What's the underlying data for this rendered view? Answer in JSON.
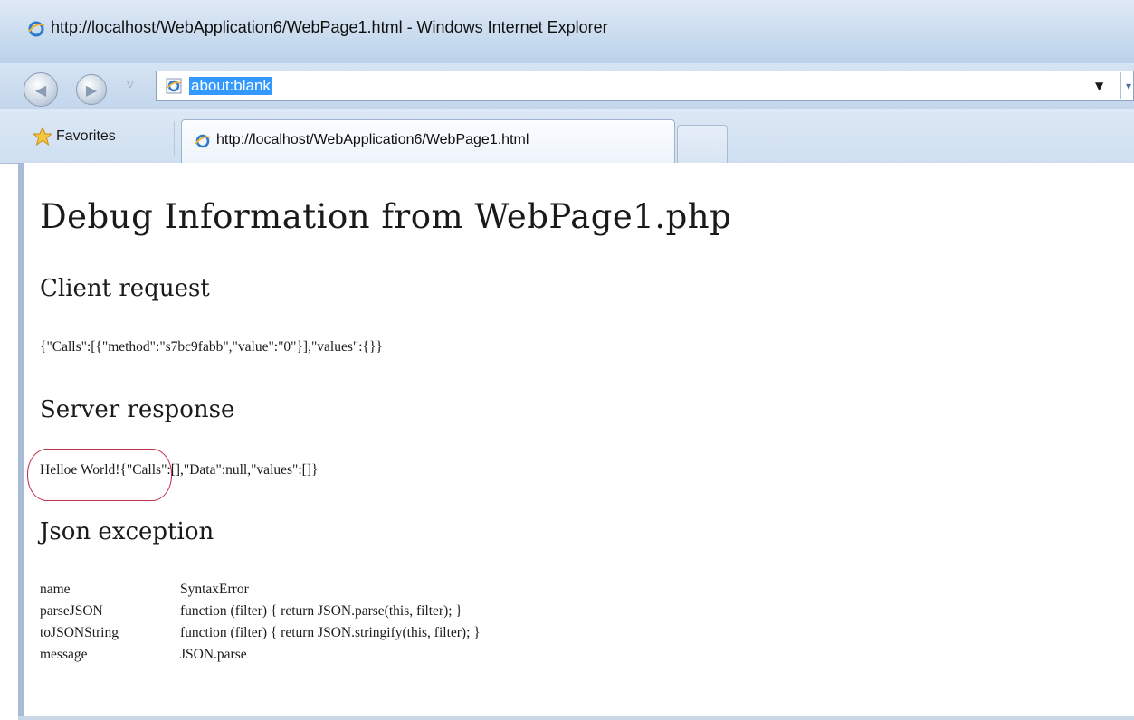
{
  "window": {
    "title": "http://localhost/WebApplication6/WebPage1.html - Windows Internet Explorer"
  },
  "navigation": {
    "address": "about:blank"
  },
  "favorites_bar": {
    "favorites_label": "Favorites",
    "active_tab_label": "http://localhost/WebApplication6/WebPage1.html"
  },
  "page": {
    "heading": "Debug Information from WebPage1.php",
    "client_request": {
      "heading": "Client request",
      "body": "{\"Calls\":[{\"method\":\"s7bc9fabb\",\"value\":\"0\"}],\"values\":{}}"
    },
    "server_response": {
      "heading": "Server response",
      "highlighted_text": "Helloe World!",
      "rest_text": "{\"Calls\":[],\"Data\":null,\"values\":[]}"
    },
    "json_exception": {
      "heading": "Json exception",
      "rows": [
        {
          "key": "name",
          "value": "SyntaxError"
        },
        {
          "key": "parseJSON",
          "value": "function (filter) { return JSON.parse(this, filter); }"
        },
        {
          "key": "toJSONString",
          "value": "function (filter) { return JSON.stringify(this, filter); }"
        },
        {
          "key": "message",
          "value": "JSON.parse"
        }
      ]
    }
  },
  "colors": {
    "highlight_oval": "#c0304a",
    "address_selection": "#3399ff"
  },
  "icons": {
    "title": "ie-logo-icon",
    "address": "ie-page-icon",
    "favorites": "favorites-star-icon",
    "tab": "ie-page-icon"
  }
}
